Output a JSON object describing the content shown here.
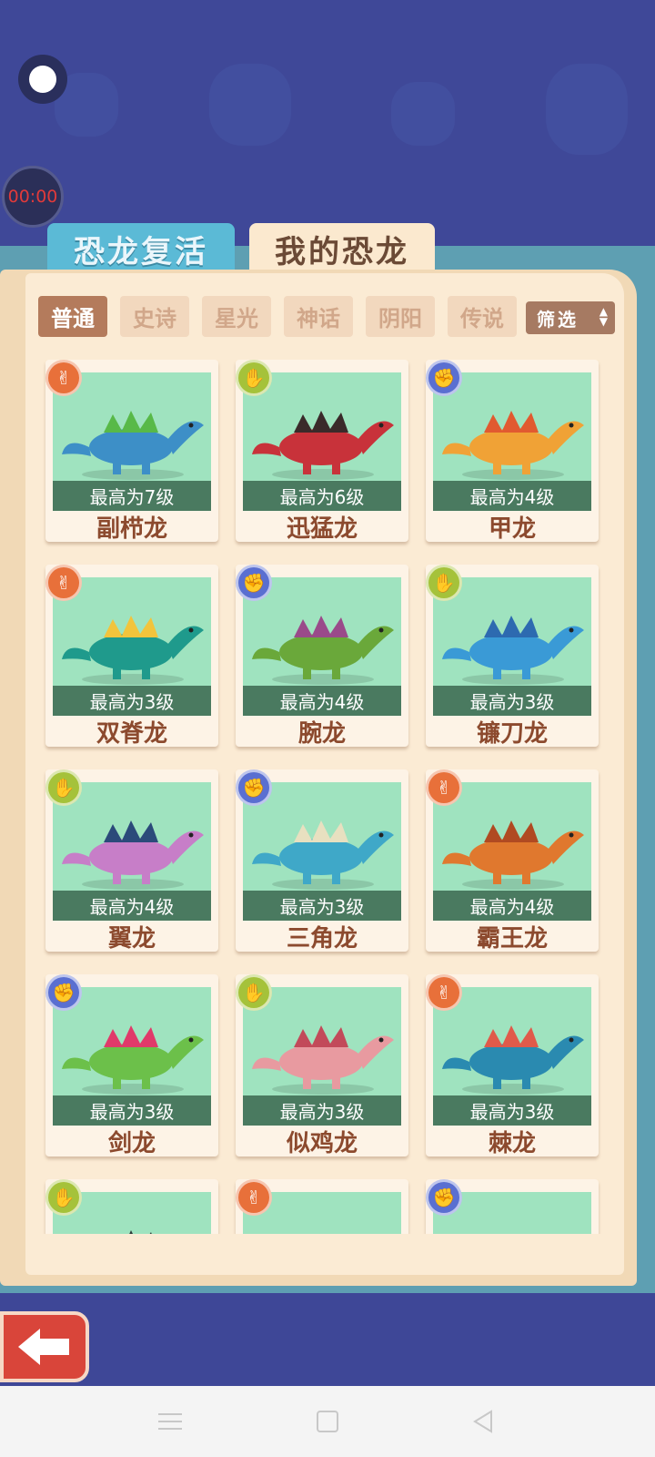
{
  "timer": "00:00",
  "tabs": {
    "revive": "恐龙复活",
    "mine": "我的恐龙"
  },
  "filters": [
    "普通",
    "史诗",
    "星光",
    "神话",
    "阴阳",
    "传说"
  ],
  "select_label": "筛选",
  "cards": [
    {
      "name": "副栉龙",
      "level": "最高为7级",
      "badge": "scissors-icon",
      "color": "#3d8fc7",
      "color2": "#58b948"
    },
    {
      "name": "迅猛龙",
      "level": "最高为6级",
      "badge": "paper-icon",
      "color": "#c8323a",
      "color2": "#3a2a2a"
    },
    {
      "name": "甲龙",
      "level": "最高为4级",
      "badge": "rock-icon",
      "color": "#f0a236",
      "color2": "#e15a30"
    },
    {
      "name": "双脊龙",
      "level": "最高为3级",
      "badge": "scissors-icon",
      "color": "#1f9a8c",
      "color2": "#f2c43c"
    },
    {
      "name": "腕龙",
      "level": "最高为4级",
      "badge": "rock-icon",
      "color": "#6aa83a",
      "color2": "#9a4a8a"
    },
    {
      "name": "镰刀龙",
      "level": "最高为3级",
      "badge": "paper-icon",
      "color": "#3a9ad6",
      "color2": "#2d6ab0"
    },
    {
      "name": "翼龙",
      "level": "最高为4级",
      "badge": "paper-icon",
      "color": "#c77ec8",
      "color2": "#2b4a7a"
    },
    {
      "name": "三角龙",
      "level": "最高为3级",
      "badge": "rock-icon",
      "color": "#3fa8c8",
      "color2": "#e8e0c0"
    },
    {
      "name": "霸王龙",
      "level": "最高为4级",
      "badge": "scissors-icon",
      "color": "#e0782e",
      "color2": "#b04a22"
    },
    {
      "name": "剑龙",
      "level": "最高为3级",
      "badge": "rock-icon",
      "color": "#6cc04a",
      "color2": "#e03a6a"
    },
    {
      "name": "似鸡龙",
      "level": "最高为3级",
      "badge": "paper-icon",
      "color": "#e89aa0",
      "color2": "#c24a5a"
    },
    {
      "name": "棘龙",
      "level": "最高为3级",
      "badge": "scissors-icon",
      "color": "#2a8ab0",
      "color2": "#e05a4a"
    },
    {
      "name": "",
      "level": "",
      "badge": "paper-icon",
      "color": "#2e3a3a",
      "color2": "#2e3a3a"
    },
    {
      "name": "",
      "level": "",
      "badge": "scissors-icon",
      "color": "#9fe3bf",
      "color2": "#9fe3bf"
    },
    {
      "name": "",
      "level": "",
      "badge": "rock-icon",
      "color": "#9fe3bf",
      "color2": "#9fe3bf"
    }
  ]
}
